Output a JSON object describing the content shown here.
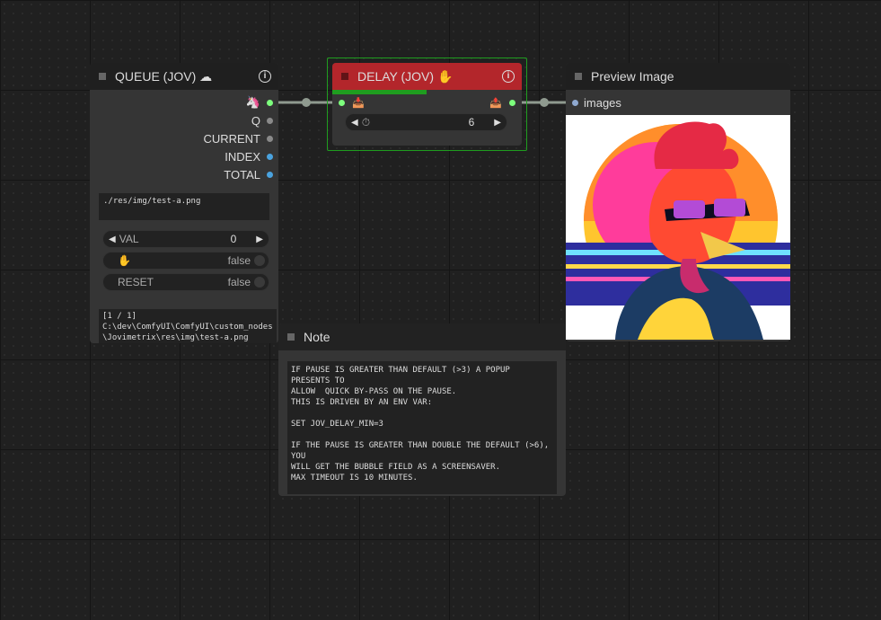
{
  "queue": {
    "title": "QUEUE (JOV) ☁",
    "outputs": [
      {
        "label": "🦄",
        "color": "#7dff7d"
      },
      {
        "label": "Q",
        "color": "#8a8a8a"
      },
      {
        "label": "CURRENT",
        "color": "#8a8a8a"
      },
      {
        "label": "INDEX",
        "color": "#4aa3df"
      },
      {
        "label": "TOTAL",
        "color": "#4aa3df"
      }
    ],
    "path_text": "./res/img/test-a.png",
    "val_label": "VAL",
    "val_value": "0",
    "pause_icon": "✋",
    "pause_value": "false",
    "reset_label": "RESET",
    "reset_value": "false",
    "status_text": "[1 / 1]\nC:\\dev\\ComfyUI\\ComfyUI\\custom_nodes\\Jovimetrix\\res\\img\\test-a.png"
  },
  "delay": {
    "title": "DELAY (JOV) ✋",
    "title_color": "#b3262b",
    "progress": 0.5,
    "input_icon": "📥",
    "output_icon": "📤",
    "timer_icon": "⏱",
    "value": "6"
  },
  "preview": {
    "title": "Preview Image",
    "input_label": "images"
  },
  "note": {
    "title": "Note",
    "text": "IF PAUSE IS GREATER THAN DEFAULT (>3) A POPUP PRESENTS TO\nALLOW  QUICK BY-PASS ON THE PAUSE.\nTHIS IS DRIVEN BY AN ENV VAR:\n\nSET JOV_DELAY_MIN=3\n\nIF THE PAUSE IS GREATER THAN DOUBLE THE DEFAULT (>6), YOU\nWILL GET THE BUBBLE FIELD AS A SCREENSAVER.\nMAX TIMEOUT IS 10 MINUTES."
  },
  "colors": {
    "link": "#8f9a8f",
    "selected_outline": "#1f9d1f"
  }
}
